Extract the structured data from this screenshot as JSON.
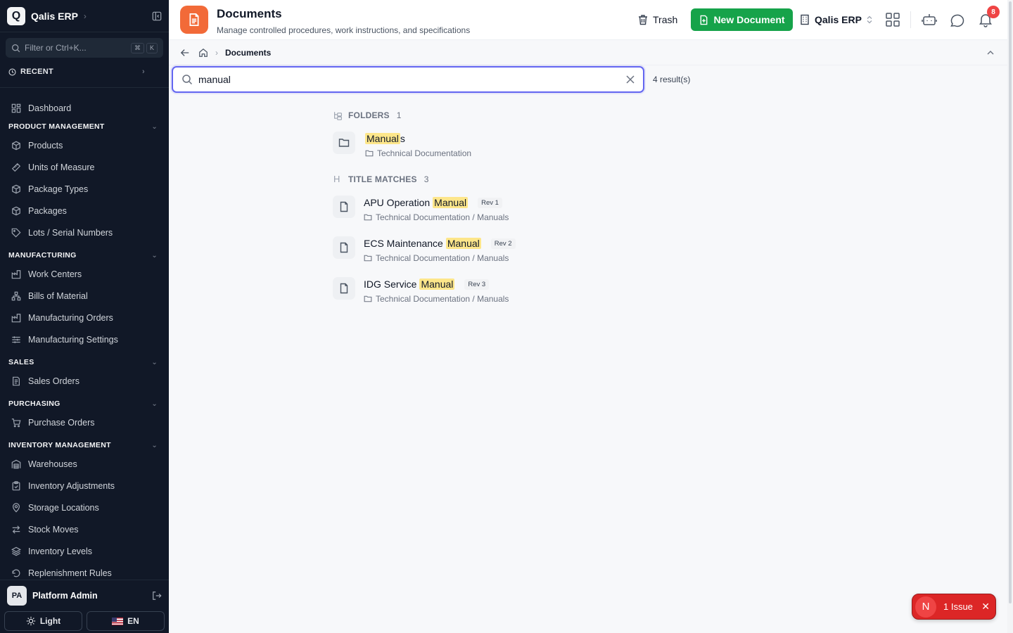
{
  "app": {
    "name": "Qalis ERP",
    "logo_letter": "Q"
  },
  "sidebar": {
    "filter_placeholder": "Filter or Ctrl+K...",
    "kbd": [
      "⌘",
      "K"
    ],
    "recent_label": "RECENT",
    "dashboard": "Dashboard",
    "sections": [
      {
        "title": "PRODUCT MANAGEMENT",
        "items": [
          "Products",
          "Units of Measure",
          "Package Types",
          "Packages",
          "Lots / Serial Numbers"
        ]
      },
      {
        "title": "MANUFACTURING",
        "items": [
          "Work Centers",
          "Bills of Material",
          "Manufacturing Orders",
          "Manufacturing Settings"
        ]
      },
      {
        "title": "SALES",
        "items": [
          "Sales Orders"
        ]
      },
      {
        "title": "PURCHASING",
        "items": [
          "Purchase Orders"
        ]
      },
      {
        "title": "INVENTORY MANAGEMENT",
        "items": [
          "Warehouses",
          "Inventory Adjustments",
          "Storage Locations",
          "Stock Moves",
          "Inventory Levels",
          "Replenishment Rules"
        ]
      }
    ],
    "user": {
      "initials": "PA",
      "name": "Platform Admin"
    },
    "theme_label": "Light",
    "lang_label": "EN"
  },
  "header": {
    "title": "Documents",
    "subtitle": "Manage controlled procedures, work instructions, and specifications",
    "trash_label": "Trash",
    "new_label": "New Document",
    "company": "Qalis ERP",
    "notif_count": "8"
  },
  "breadcrumb": {
    "current": "Documents"
  },
  "search": {
    "value": "manual",
    "result_count": "4 result(s)"
  },
  "folders": {
    "label": "FOLDERS",
    "count": "1",
    "items": [
      {
        "match": "Manual",
        "rest": "s",
        "path": "Technical Documentation"
      }
    ]
  },
  "title_matches": {
    "label": "TITLE MATCHES",
    "count": "3",
    "items": [
      {
        "prefix": "APU Operation ",
        "match": "Manual",
        "rev": "Rev 1",
        "path": "Technical Documentation / Manuals"
      },
      {
        "prefix": "ECS Maintenance ",
        "match": "Manual",
        "rev": "Rev 2",
        "path": "Technical Documentation / Manuals"
      },
      {
        "prefix": "IDG Service ",
        "match": "Manual",
        "rev": "Rev 3",
        "path": "Technical Documentation / Manuals"
      }
    ]
  },
  "issue": {
    "letter": "N",
    "label": "1 Issue"
  },
  "colors": {
    "accent": "#6366f1",
    "primary_action": "#16a34a",
    "page_icon": "#f26a38",
    "sidebar_bg": "#111827",
    "highlight": "#fde68a",
    "issue": "#dc2626"
  }
}
